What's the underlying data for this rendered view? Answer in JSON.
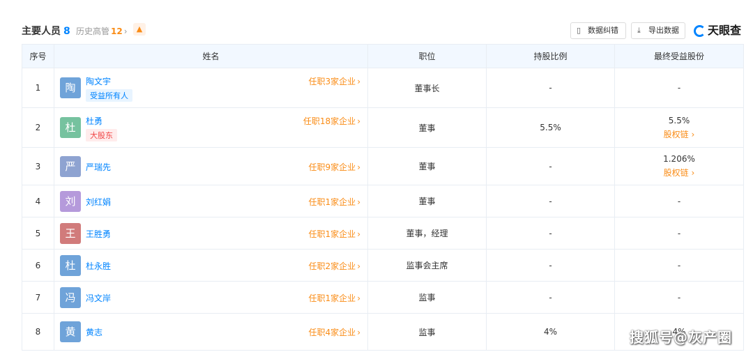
{
  "header": {
    "title": "主要人员",
    "count": "8",
    "history_label": "历史高管",
    "history_count": "12",
    "correct_button": "数据纠错",
    "export_button": "导出数据",
    "logo": "天眼查"
  },
  "table": {
    "columns": [
      "序号",
      "姓名",
      "职位",
      "持股比例",
      "最终受益股份"
    ],
    "rows": [
      {
        "no": "1",
        "avatar": "陶",
        "avatar_color": "#6fa3d9",
        "name": "陶文宇",
        "tag": "受益所有人",
        "tag_type": "blue",
        "jobs": "任职3家企业",
        "position": "董事长",
        "share": "-",
        "final": "-",
        "chain": ""
      },
      {
        "no": "2",
        "avatar": "杜",
        "avatar_color": "#76c29f",
        "name": "杜勇",
        "tag": "大股东",
        "tag_type": "red",
        "jobs": "任职18家企业",
        "position": "董事",
        "share": "5.5%",
        "final": "5.5%",
        "chain": "股权链"
      },
      {
        "no": "3",
        "avatar": "严",
        "avatar_color": "#8ea3d1",
        "name": "严瑞先",
        "tag": "",
        "tag_type": "",
        "jobs": "任职9家企业",
        "position": "董事",
        "share": "-",
        "final": "1.206%",
        "chain": "股权链"
      },
      {
        "no": "4",
        "avatar": "刘",
        "avatar_color": "#b59adb",
        "name": "刘红娟",
        "tag": "",
        "tag_type": "",
        "jobs": "任职1家企业",
        "position": "董事",
        "share": "-",
        "final": "-",
        "chain": ""
      },
      {
        "no": "5",
        "avatar": "王",
        "avatar_color": "#d17b7b",
        "name": "王胜勇",
        "tag": "",
        "tag_type": "",
        "jobs": "任职1家企业",
        "position": "董事，经理",
        "share": "-",
        "final": "-",
        "chain": ""
      },
      {
        "no": "6",
        "avatar": "杜",
        "avatar_color": "#6fa3d9",
        "name": "杜永胜",
        "tag": "",
        "tag_type": "",
        "jobs": "任职2家企业",
        "position": "监事会主席",
        "share": "-",
        "final": "-",
        "chain": ""
      },
      {
        "no": "7",
        "avatar": "冯",
        "avatar_color": "#6fa3d9",
        "name": "冯文岸",
        "tag": "",
        "tag_type": "",
        "jobs": "任职1家企业",
        "position": "监事",
        "share": "-",
        "final": "-",
        "chain": ""
      },
      {
        "no": "8",
        "avatar": "黄",
        "avatar_color": "#6fa3d9",
        "name": "黄志",
        "tag": "",
        "tag_type": "",
        "jobs": "任职4家企业",
        "position": "监事",
        "share": "4%",
        "final": "4%",
        "chain": ""
      }
    ]
  },
  "watermark": "搜狐号@灰产圈"
}
